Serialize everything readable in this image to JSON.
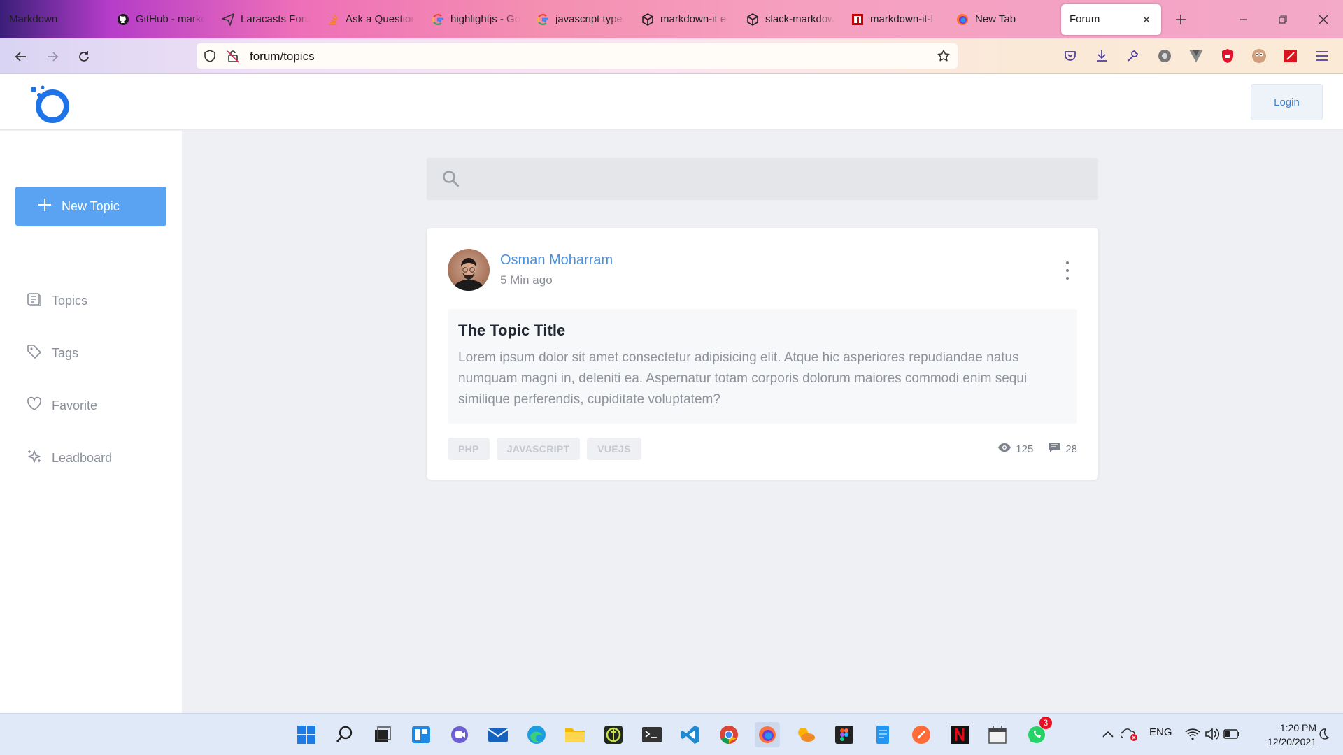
{
  "browser": {
    "tabs": [
      {
        "title": "Markdown",
        "icon": "none"
      },
      {
        "title": "GitHub - markdown",
        "icon": "github-icon"
      },
      {
        "title": "Laracasts Forum",
        "icon": "laracasts-icon"
      },
      {
        "title": "Ask a Question",
        "icon": "stackoverflow-icon"
      },
      {
        "title": "highlightjs - Google",
        "icon": "google-icon"
      },
      {
        "title": "javascript type",
        "icon": "google-icon"
      },
      {
        "title": "markdown-it e",
        "icon": "codesandbox-icon"
      },
      {
        "title": "slack-markdown",
        "icon": "codesandbox-icon"
      },
      {
        "title": "markdown-it-l",
        "icon": "npm-icon"
      },
      {
        "title": "New Tab",
        "icon": "firefox-icon"
      }
    ],
    "active_tab": "Forum",
    "url": "forum/topics"
  },
  "header": {
    "login_label": "Login"
  },
  "sidebar": {
    "new_topic_label": "New Topic",
    "items": [
      {
        "label": "Topics",
        "icon": "topics-icon"
      },
      {
        "label": "Tags",
        "icon": "tag-icon"
      },
      {
        "label": "Favorite",
        "icon": "heart-icon"
      },
      {
        "label": "Leadboard",
        "icon": "sparkle-icon"
      }
    ]
  },
  "search": {
    "placeholder": ""
  },
  "topic": {
    "author": "Osman Moharram",
    "time": "5 Min ago",
    "title": "The Topic Title",
    "body": "Lorem ipsum dolor sit amet consectetur adipisicing elit. Atque hic asperiores repudiandae natus numquam magni in, deleniti ea. Aspernatur totam corporis dolorum maiores commodi enim sequi similique perferendis, cupiditate voluptatem?",
    "tags": [
      "PHP",
      "JAVASCRIPT",
      "VUEJS"
    ],
    "views": "125",
    "comments": "28"
  },
  "taskbar": {
    "language": "ENG",
    "time": "1:20 PM",
    "date": "12/20/2021",
    "whatsapp_badge": "3"
  },
  "colors": {
    "accent": "#5aa3f3",
    "link": "#4a90d9",
    "background": "#eef0f3"
  }
}
